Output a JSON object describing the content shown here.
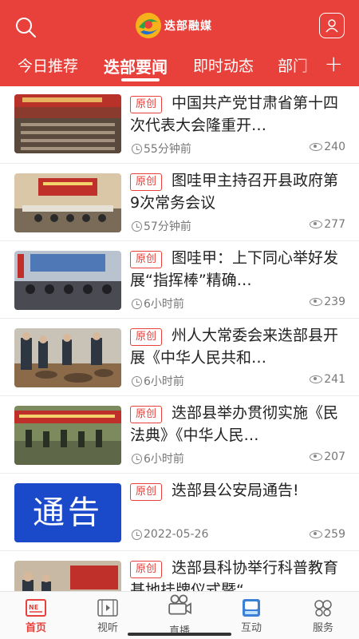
{
  "app": {
    "logo_text": "迭部融媒"
  },
  "header": {
    "search_icon": "search-icon",
    "user_icon": "user-icon",
    "accent_color": "#e8403a"
  },
  "tabs": [
    {
      "label": "今日推荐"
    },
    {
      "label": "迭部要闻",
      "active": true
    },
    {
      "label": "即时动态"
    },
    {
      "label": "部门"
    }
  ],
  "tabs_add_label": "+",
  "news": [
    {
      "badge": "原创",
      "title": "中国共产党甘肃省第十四次代表大会隆重开…",
      "time": "55分钟前",
      "views": "240"
    },
    {
      "badge": "原创",
      "title": "图哇甲主持召开县政府第9次常务会议",
      "time": "57分钟前",
      "views": "277"
    },
    {
      "badge": "原创",
      "title": "图哇甲：上下同心举好发展“指挥棒”精确…",
      "time": "6小时前",
      "views": "239"
    },
    {
      "badge": "原创",
      "title": "州人大常委会来迭部县开展《中华人民共和…",
      "time": "6小时前",
      "views": "241"
    },
    {
      "badge": "原创",
      "title": "迭部县举办贯彻实施《民法典》《中华人民…",
      "time": "6小时前",
      "views": "207"
    },
    {
      "badge": "原创",
      "title": "迭部县公安局通告!",
      "time": "2022-05-26",
      "views": "259",
      "thumb_text": "通告"
    },
    {
      "badge": "原创",
      "title": "迭部县科协举行科普教育基地挂牌仪式暨“…",
      "time": "",
      "views": ""
    }
  ],
  "bottom_nav": [
    {
      "label": "首页",
      "icon": "news-icon",
      "active": true
    },
    {
      "label": "视听",
      "icon": "film-icon"
    },
    {
      "label": "直播",
      "icon": "camera-icon"
    },
    {
      "label": "互动",
      "icon": "interact-icon"
    },
    {
      "label": "服务",
      "icon": "service-icon"
    }
  ]
}
